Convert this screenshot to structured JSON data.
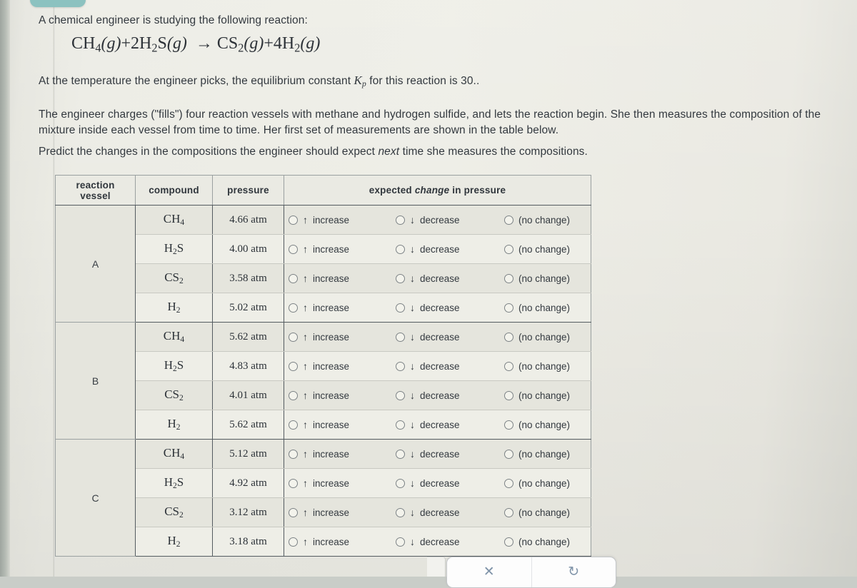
{
  "problem": {
    "intro": "A chemical engineer is studying the following reaction:",
    "equation": {
      "reactant1": "CH",
      "reactant1_sub": "4",
      "reactant1_state": "(g)",
      "plus1": "+",
      "reactant2_coeff": "2",
      "reactant2": "H",
      "reactant2_sub": "2",
      "reactant2b": "S",
      "reactant2_state": "(g)",
      "arrow": "→",
      "product1": "CS",
      "product1_sub": "2",
      "product1_state": "(g)",
      "plus2": "+",
      "product2_coeff": "4",
      "product2": "H",
      "product2_sub": "2",
      "product2_state": "(g)",
      "plain": "CH4(g)+2H2S(g) → CS2(g)+4H2(g)"
    },
    "kp_sentence_before": "At the temperature the engineer picks, the equilibrium constant ",
    "kp_symbol": "K",
    "kp_subscript": "p",
    "kp_sentence_after": " for this reaction is 30..",
    "paragraph2": "The engineer charges (\"fills\") four reaction vessels with methane and hydrogen sulfide, and lets the reaction begin. She then measures the composition of the mixture inside each vessel from time to time. Her first set of measurements are shown in the table below.",
    "paragraph3_before": "Predict the changes in the compositions the engineer should expect ",
    "paragraph3_emph": "next",
    "paragraph3_after": " time she measures the compositions."
  },
  "table": {
    "headers": {
      "vessel_line1": "reaction",
      "vessel_line2": "vessel",
      "compound": "compound",
      "pressure": "pressure",
      "change_before": "expected ",
      "change_emph": "change",
      "change_after": " in pressure"
    },
    "options": [
      {
        "label": "increase",
        "arrow": "↑",
        "name": "increase"
      },
      {
        "label": "decrease",
        "arrow": "↓",
        "name": "decrease"
      },
      {
        "label": "(no change)",
        "arrow": "",
        "name": "no-change"
      }
    ],
    "vessels": [
      {
        "name": "A",
        "rows": [
          {
            "formula": "CH",
            "sub": "4",
            "suffix": "",
            "pressure": "4.66 atm"
          },
          {
            "formula": "H",
            "sub": "2",
            "suffix": "S",
            "pressure": "4.00 atm"
          },
          {
            "formula": "CS",
            "sub": "2",
            "suffix": "",
            "pressure": "3.58 atm"
          },
          {
            "formula": "H",
            "sub": "2",
            "suffix": "",
            "pressure": "5.02 atm"
          }
        ]
      },
      {
        "name": "B",
        "rows": [
          {
            "formula": "CH",
            "sub": "4",
            "suffix": "",
            "pressure": "5.62 atm"
          },
          {
            "formula": "H",
            "sub": "2",
            "suffix": "S",
            "pressure": "4.83 atm"
          },
          {
            "formula": "CS",
            "sub": "2",
            "suffix": "",
            "pressure": "4.01 atm"
          },
          {
            "formula": "H",
            "sub": "2",
            "suffix": "",
            "pressure": "5.62 atm"
          }
        ]
      },
      {
        "name": "C",
        "rows": [
          {
            "formula": "CH",
            "sub": "4",
            "suffix": "",
            "pressure": "5.12 atm"
          },
          {
            "formula": "H",
            "sub": "2",
            "suffix": "S",
            "pressure": "4.92 atm"
          },
          {
            "formula": "CS",
            "sub": "2",
            "suffix": "",
            "pressure": "3.12 atm"
          },
          {
            "formula": "H",
            "sub": "2",
            "suffix": "",
            "pressure": "3.18 atm"
          }
        ]
      }
    ]
  },
  "bottom_bar": {
    "close_icon": "✕",
    "refresh_icon": "↻"
  },
  "colors": {
    "teal_tab": "#8cc2c0",
    "paper": "#eeeee7",
    "text": "#33393f",
    "table_border": "#545b60",
    "bottom_icon": "#7f93a8"
  }
}
